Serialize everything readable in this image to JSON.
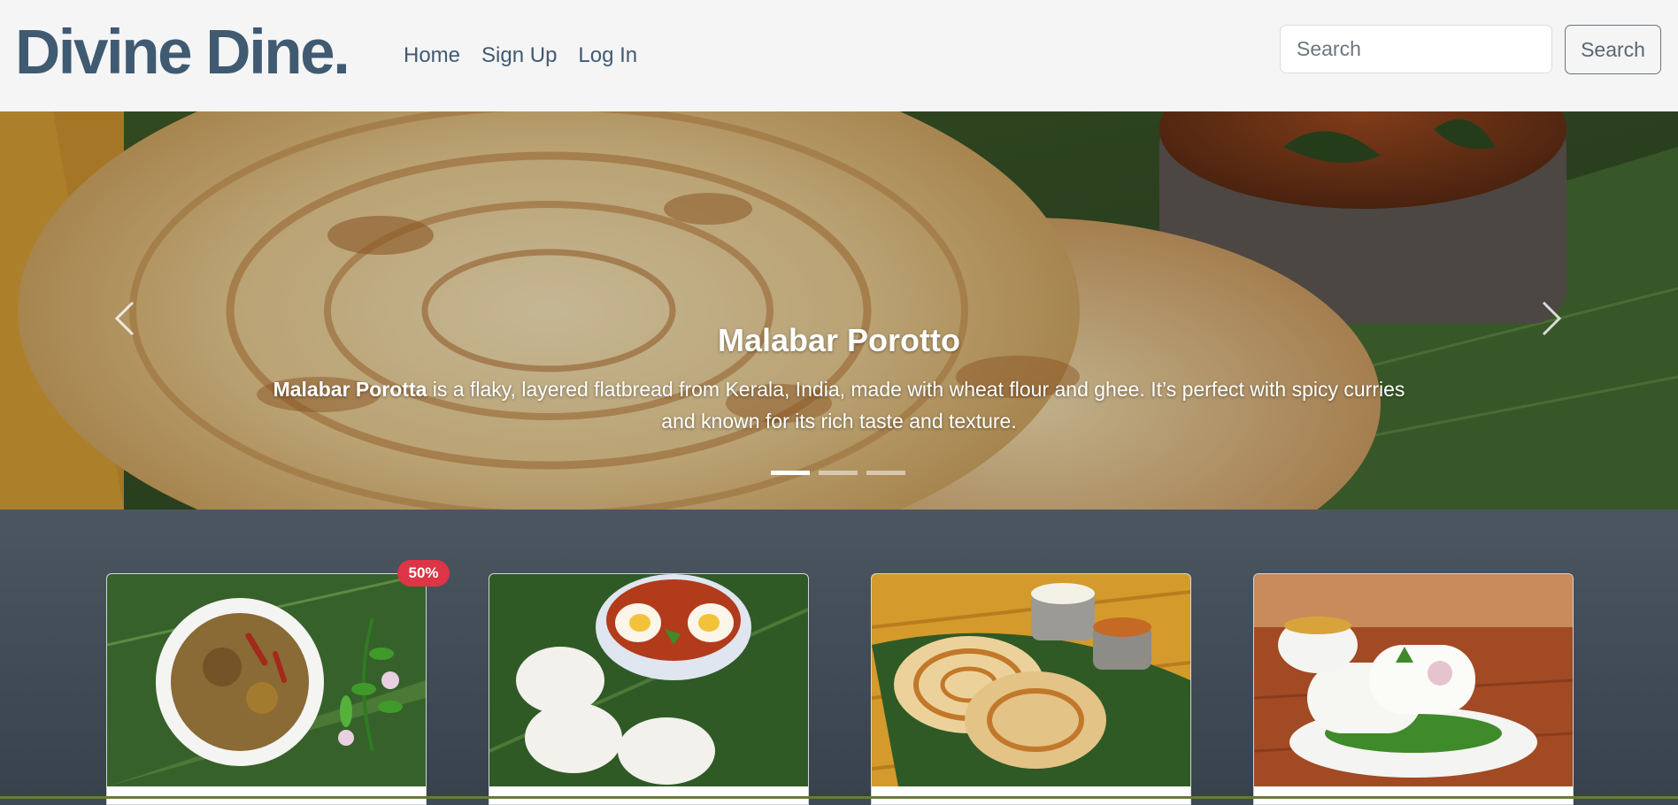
{
  "navbar": {
    "brand": "Divine Dine.",
    "links": [
      "Home",
      "Sign Up",
      "Log In"
    ],
    "search_placeholder": "Search",
    "search_button": "Search"
  },
  "carousel": {
    "title": "Malabar Porotto",
    "description_bold": "Malabar Porotta",
    "description_rest": " is a flaky, layered flatbread from Kerala, India, made with wheat flour and ghee. It’s perfect with spicy curries and known for its rich taste and texture.",
    "active_slide": 1,
    "slide_count": 3
  },
  "cards": [
    {
      "name": "card-dish-1",
      "badge": "50%"
    },
    {
      "name": "card-dish-2"
    },
    {
      "name": "card-dish-3"
    },
    {
      "name": "card-dish-4"
    }
  ],
  "colors": {
    "brand": "#405a72",
    "badge": "#dc3545"
  }
}
